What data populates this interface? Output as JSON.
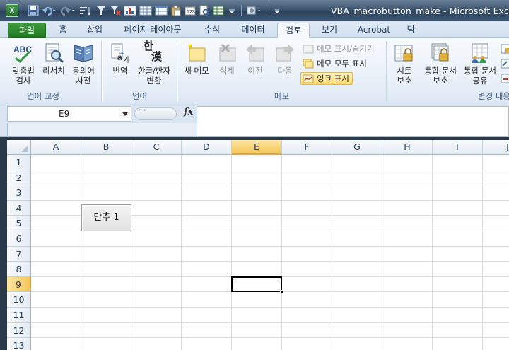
{
  "window": {
    "title": "VBA_macrobutton_make  -  Microsoft Excel",
    "app_icon": "X"
  },
  "quick_access": [
    "save-icon",
    "undo-icon",
    "redo-icon"
  ],
  "tabs": [
    {
      "label": "파일",
      "active": false,
      "file": true
    },
    {
      "label": "홈",
      "active": false
    },
    {
      "label": "삽입",
      "active": false
    },
    {
      "label": "페이지 레이아웃",
      "active": false
    },
    {
      "label": "수식",
      "active": false
    },
    {
      "label": "데이터",
      "active": false
    },
    {
      "label": "검토",
      "active": true
    },
    {
      "label": "보기",
      "active": false
    },
    {
      "label": "Acrobat",
      "active": false
    },
    {
      "label": "팀",
      "active": false
    }
  ],
  "ribbon": {
    "proofing": {
      "spell_line1": "맞춤법",
      "spell_line2": "검사",
      "research": "리서치",
      "thesaurus_line1": "동의어",
      "thesaurus_line2": "사전",
      "group_label": "언어 교정"
    },
    "language": {
      "translate": "번역",
      "hanja_line1": "한글/한자",
      "hanja_line2": "변환",
      "hanja_glyph_top": "한",
      "hanja_glyph_bottom": "漢",
      "group_label": "언어"
    },
    "comments": {
      "new_comment": "새 메모",
      "delete": "삭제",
      "previous": "이전",
      "next": "다음",
      "show_hide": "메모 표시/숨기기",
      "show_all": "메모 모두 표시",
      "show_ink": "잉크 표시",
      "group_label": "메모"
    },
    "changes": {
      "protect_sheet_line1": "시트",
      "protect_sheet_line2": "보호",
      "protect_workbook_line1": "통합 문서",
      "protect_workbook_line2": "보호",
      "share_workbook_line1": "통합 문서",
      "share_workbook_line2": "공유",
      "group_label": "변경 내용"
    }
  },
  "formula_bar": {
    "name_box": "E9",
    "fx": "fx",
    "formula": ""
  },
  "sheet": {
    "columns": [
      "A",
      "B",
      "C",
      "D",
      "E",
      "F",
      "G",
      "H",
      "I",
      "J"
    ],
    "rows": [
      "1",
      "2",
      "3",
      "4",
      "5",
      "6",
      "7",
      "8",
      "9",
      "10",
      "11",
      "12",
      "13"
    ],
    "selected_column": "E",
    "selected_row": "9",
    "macro_button_label": "단추 1"
  },
  "colors": {
    "file_tab": "#2a8a2c",
    "selected_header": "#f5c75a",
    "ink_highlight": "#ffd965"
  }
}
